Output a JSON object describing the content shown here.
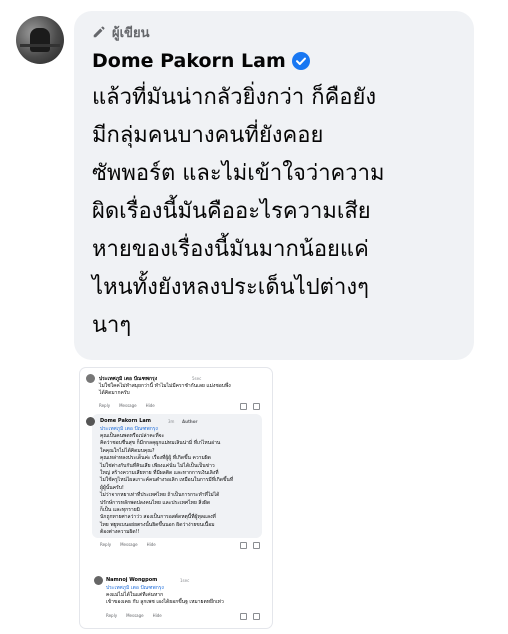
{
  "comment": {
    "author_badge": "ผู้เขียน",
    "author_name": "Dome Pakorn Lam",
    "text": "แล้วที่มันน่ากลัวยิ่งกว่า ก็คือยัง\nมีกลุ่มคนบางคนที่ยังคอย\nซัพพอร์ต และไม่เข้าใจว่าความ\nผิดเรื่องนี้มันคืออะไรความเสีย\nหายของเรื่องนี้มันมากน้อยแค่\nไหนทั้งยังหลงประเด็นไปต่างๆ\nนาๆ"
  },
  "screenshot": {
    "comment1": {
      "name": "ประเทศภูมิ เตอ ปัณฑพกรุง",
      "time": "5sec",
      "text": "ไม่ใช่ใคคไม่ทำสมุยกว่านี้ ทำไมไม่มีคราชำกันเลย แม่งชอบพึ่ง\nได้คิดมากครับ",
      "actions": [
        "Reply",
        "Message",
        "Hide"
      ]
    },
    "comment2": {
      "name": "Dome Pakorn Lam",
      "time": "3m",
      "badge": "Author",
      "mention": "ประเทศภูมิ เตอ ปัณฑพกรุง",
      "text": "คุณเป็นคนพดหรือเปล่าคะที่จะ\nคิดว่าชอบชื่นสุข ก็มีกกลคุผูกแม่ทมเลินน่ามิ่ ที่เก่ไหนอ่าน\nใคคุณใกไม่ได้คิดมบคุณ?\nคุณเหล่าหลงประเด็นค่ะ เรื่องที่ผู้ผู้ ที่เกิดขึ้น ความผิด\nไม่ใช่ต่างกับกันที่คินเสีย เพียงแค่นั่น ไม่ได้เป็นเป็นข่าว\nใหญ่ สร้างความเสียหาย ที่มีผลติด และหากการเงินเลิงที่\nไม่ใช้ครูไหน่ไผลเกาะค์คนตำงรอเลิก เหมือนในการมีที่เกิดขึ้นที่\nผู้ผู้นั้นครับ!\nไม่ว่าจากหยาเท่าที่ประเทศไทย ถ้าเป็นการกระทำที่ไม่ได้\nปรักษ์การหลักพดปลงคนไทย และประเทศไทย สิ่งผิด\nก็เป็น และทุกรายมิ\nนักถูกทายศาลว่าว่ว สองเป็นการอสต์ดหตุนี้ที่ผู้ทุลแลงที่\nไทย พยูทเบนอย่ยตรงนั้นยิดขึ้นนอก ผิดว่าง่ายขนเนื้อม\nต้องต่างความผิด!!",
      "actions": [
        "Reply",
        "Message",
        "Hide"
      ]
    },
    "comment3": {
      "name": "Namnoj Wongpom",
      "time": "1sec",
      "mention": "ประเทศภูมิ เตอ ปัณฑพกรุง",
      "text": "คงแม่ไม่ได้ในแต่ทีเค่นหาก\nเข้าของเคธ กับ ลูกเพช เองได้ยอกขึ้นฐ เหมายตหยึกเท่ว",
      "actions": [
        "Reply",
        "Message",
        "Hide"
      ]
    }
  },
  "colors": {
    "bubble": "#f0f2f5",
    "verified": "#1877f2",
    "text": "#050505",
    "muted": "#65676b",
    "link": "#216fdb"
  },
  "icons": {
    "badge": "pencil-icon",
    "verified": "verified-badge-icon"
  }
}
